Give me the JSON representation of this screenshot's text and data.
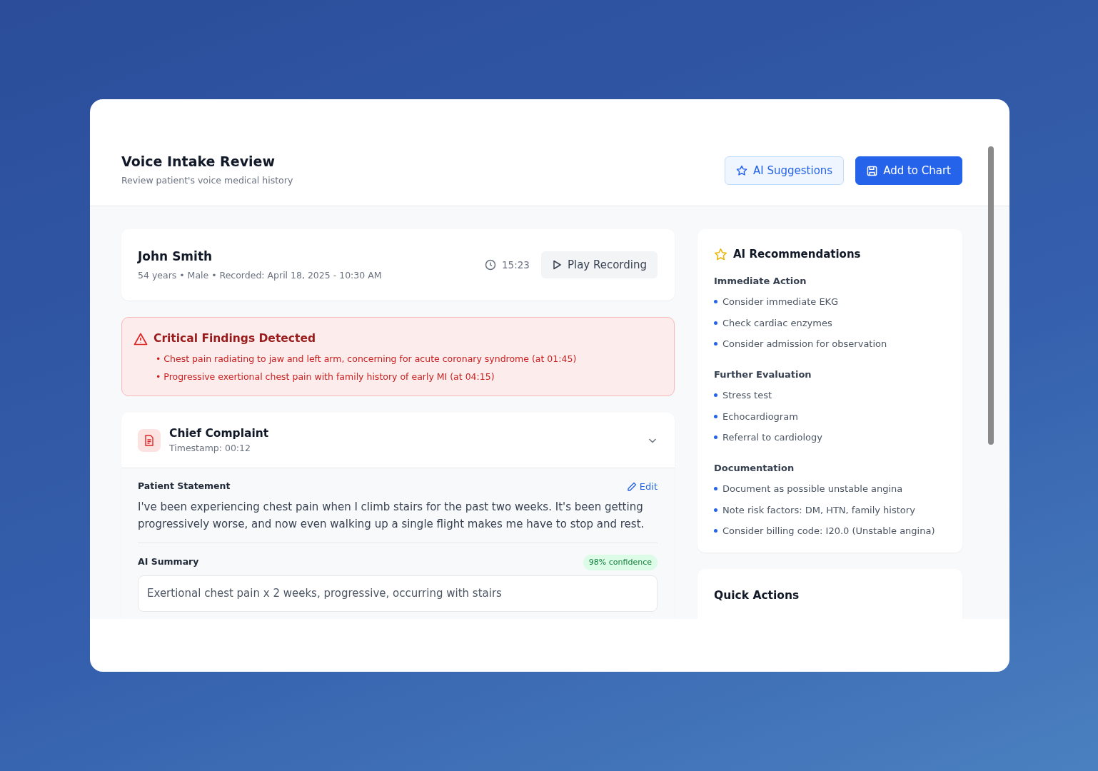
{
  "header": {
    "title": "Voice Intake Review",
    "subtitle": "Review patient's voice medical history",
    "buttons": [
      {
        "kind": "outline",
        "label": "AI Suggestions"
      },
      {
        "kind": "primary",
        "label": "Add to Chart"
      }
    ]
  },
  "patient": {
    "name": "John Smith",
    "details": "54 years • Male • Recorded: April 18, 2025 - 10:30 AM",
    "duration": "15:23",
    "play_label": "Play Recording"
  },
  "alert": {
    "title": "Critical Findings Detected",
    "items": [
      "• Chest pain radiating to jaw and left arm, concerning for acute coronary syndrome (at 01:45)",
      "• Progressive exertional chest pain with family history of early MI (at 04:15)"
    ]
  },
  "section": {
    "title": "Chief Complaint",
    "timestamp": "Timestamp: 00:12",
    "expanded": true,
    "statement_label": "Patient Statement",
    "edit_label": "Edit",
    "statement": "I've been experiencing chest pain when I climb stairs for the past two weeks. It's been getting progressively worse, and now even walking up a single flight makes me have to stop and rest.",
    "summary_label": "AI Summary",
    "confidence": "98% confidence",
    "summary": "Exertional chest pain x 2 weeks, progressive, occurring with stairs"
  },
  "recommendations": {
    "title": "AI Recommendations",
    "groups": [
      {
        "heading": "Immediate Action",
        "items": [
          "Consider immediate EKG",
          "Check cardiac enzymes",
          "Consider admission for observation"
        ]
      },
      {
        "heading": "Further Evaluation",
        "items": [
          "Stress test",
          "Echocardiogram",
          "Referral to cardiology"
        ]
      },
      {
        "heading": "Documentation",
        "items": [
          "Document as possible unstable angina",
          "Note risk factors: DM, HTN, family history",
          "Consider billing code: I20.0 (Unstable angina)"
        ]
      }
    ]
  },
  "quick_actions": {
    "title": "Quick Actions"
  }
}
